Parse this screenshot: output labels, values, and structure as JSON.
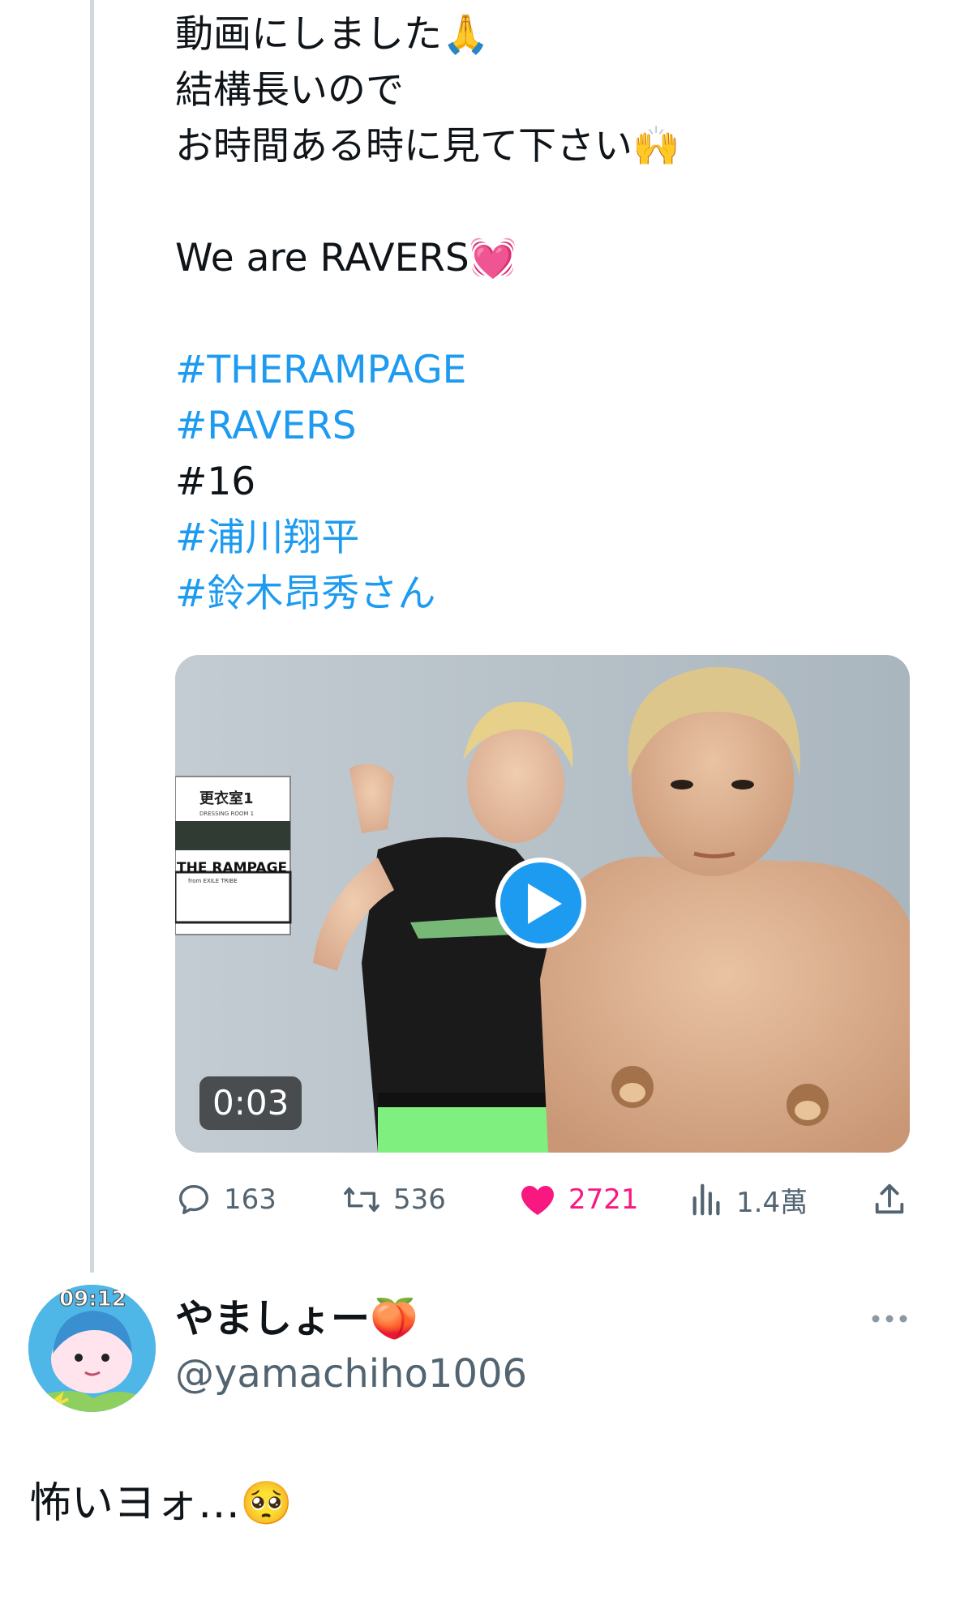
{
  "tweet": {
    "lines": [
      "動画にしました🙏",
      "結構長いので",
      "お時間ある時に見て下さい🙌",
      "",
      "We are RAVERS💓",
      ""
    ],
    "hashtags": [
      {
        "text": "#THERAMPAGE",
        "link": true
      },
      {
        "text": "#RAVERS",
        "link": true
      },
      {
        "text": "#16",
        "link": false
      },
      {
        "text": "#浦川翔平",
        "link": true
      },
      {
        "text": "#鈴木昂秀さん",
        "link": true
      }
    ],
    "media": {
      "duration": "0:03",
      "sign_title": "更衣室1",
      "sign_subtitle": "DRESSING ROOM 1",
      "sign_name": "THE RAMPAGE",
      "sign_from": "from EXILE TRIBE"
    },
    "actions": {
      "replies": "163",
      "retweets": "536",
      "likes": "2721",
      "views": "1.4萬"
    }
  },
  "reply": {
    "display_name": "やましょー🍑",
    "handle": "@yamachiho1006",
    "avatar_text": "09:12",
    "text": "怖いヨォ…🥺"
  },
  "colors": {
    "link": "#1d9bf0",
    "like": "#f91880",
    "muted": "#536471",
    "thread_line": "#cfd9de"
  }
}
